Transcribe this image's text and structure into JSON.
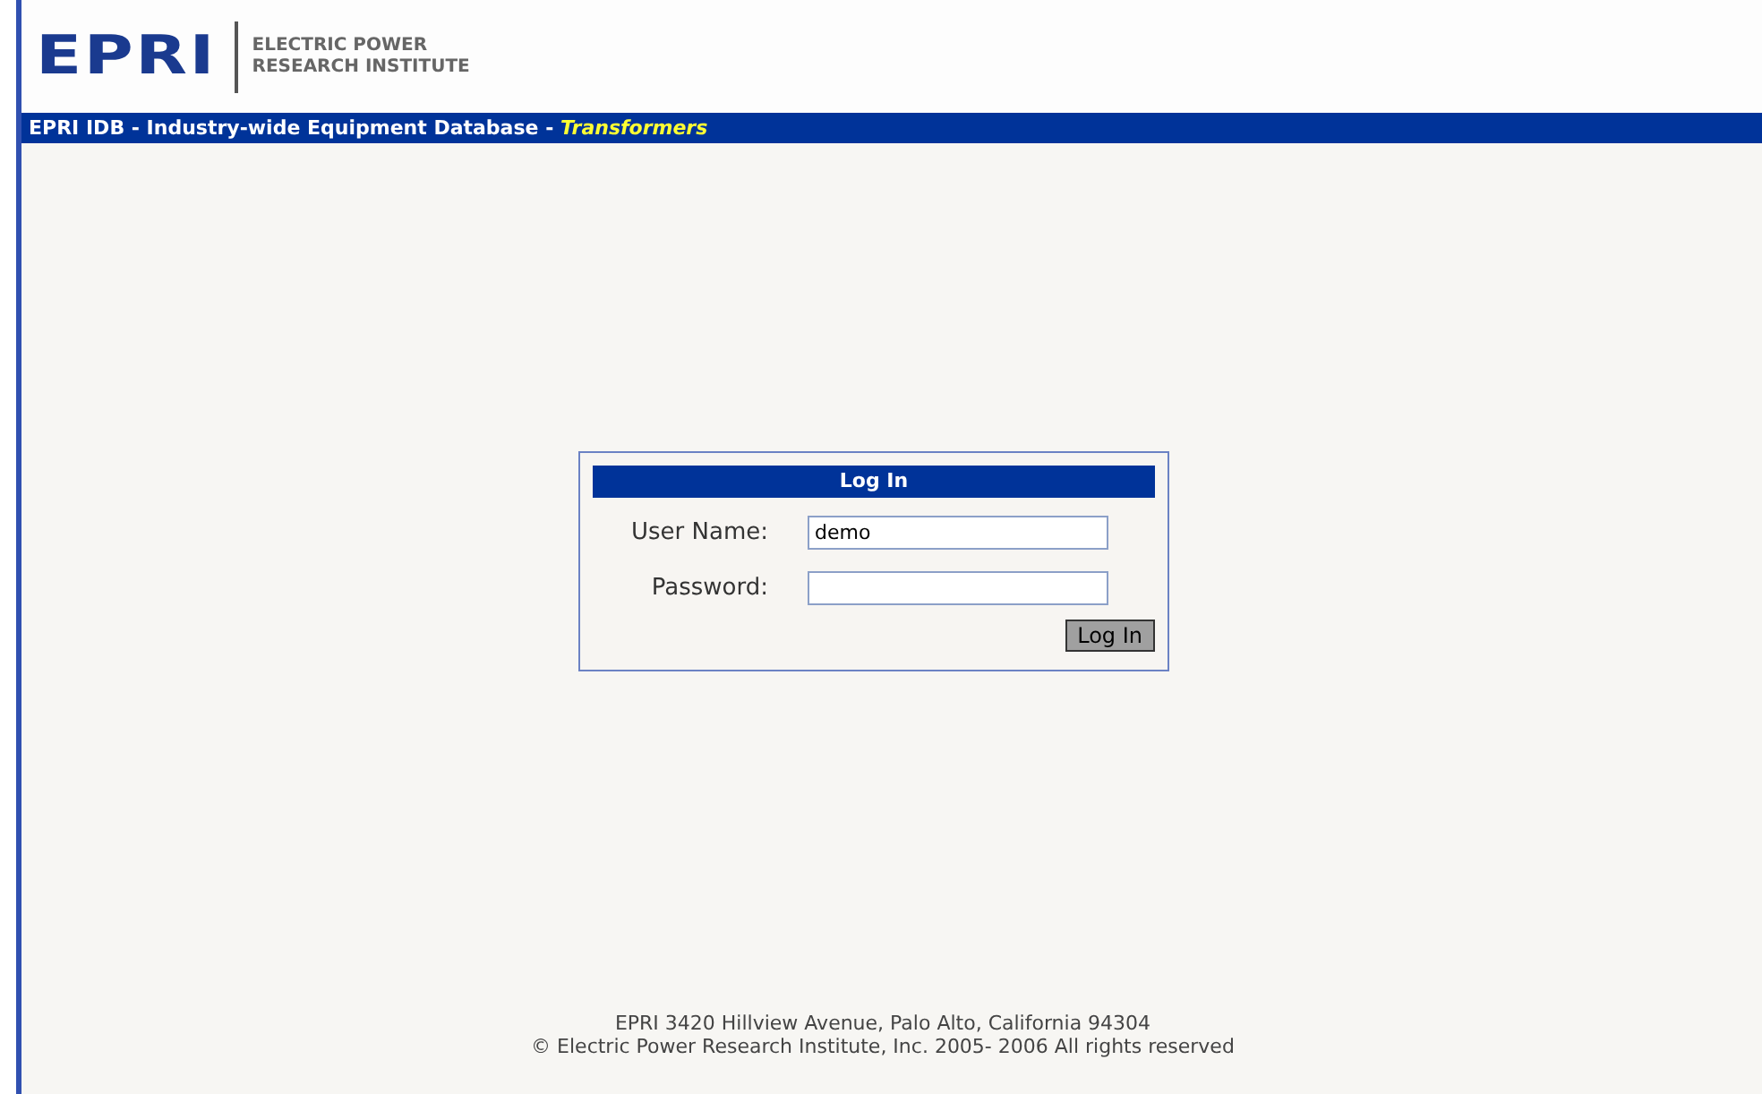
{
  "logo": {
    "mark": "EPRI",
    "line_1": "ELECTRIC POWER",
    "line_2": "RESEARCH INSTITUTE"
  },
  "title_bar": {
    "title": "EPRI IDB - Industry-wide Equipment Database - ",
    "section": "Transformers"
  },
  "login": {
    "heading": "Log In",
    "fields": [
      {
        "label": "User Name:",
        "value": "demo"
      },
      {
        "label": "Password:"
      }
    ],
    "button": "Log In"
  },
  "footer": [
    "EPRI 3420 Hillview Avenue, Palo Alto, California 94304",
    "© Electric Power Research Institute, Inc. 2005- 2006 All rights reserved"
  ]
}
